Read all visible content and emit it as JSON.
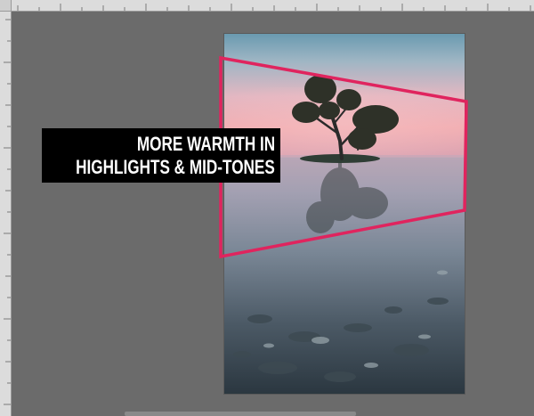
{
  "caption": {
    "line1": "MORE WARMTH IN",
    "line2": "HIGHLIGHTS & MID-TONES"
  },
  "colors": {
    "workspace": "#6b6b6b",
    "ruler": "#dcdcdc",
    "highlight_frame": "#e0245e",
    "caption_bg": "#000000",
    "caption_text": "#ffffff"
  },
  "icons": {
    "selection_frame": "trapezoid-outline"
  }
}
